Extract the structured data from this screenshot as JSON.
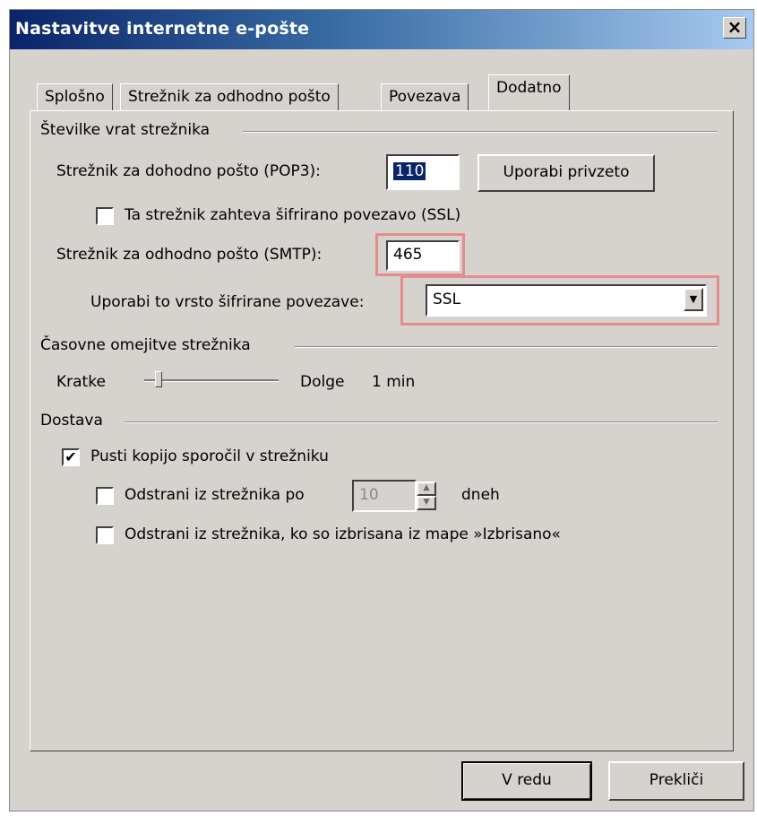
{
  "window": {
    "title": "Nastavitve internetne e-pošte",
    "close_label": "×"
  },
  "tabs": [
    {
      "label": "Splošno",
      "active": false
    },
    {
      "label": "Strežnik za odhodno pošto",
      "active": false
    },
    {
      "label": "Povezava",
      "active": false
    },
    {
      "label": "Dodatno",
      "active": true
    }
  ],
  "ports": {
    "group_title": "Številke vrat strežnika",
    "pop3_label": "Strežnik za dohodno pošto (POP3):",
    "pop3_value": "110",
    "use_default_button": "Uporabi privzeto",
    "ssl_checkbox_label": "Ta strežnik zahteva šifrirano povezavo (SSL)",
    "ssl_checked": false,
    "smtp_label": "Strežnik za odhodno pošto (SMTP):",
    "smtp_value": "465",
    "encryption_label": "Uporabi to vrsto šifrirane povezave:",
    "encryption_value": "SSL"
  },
  "timeouts": {
    "group_title": "Časovne omejitve strežnika",
    "short_label": "Kratke",
    "long_label": "Dolge",
    "value_label": "1 min"
  },
  "delivery": {
    "group_title": "Dostava",
    "leave_copy_label": "Pusti kopijo sporočil v strežniku",
    "leave_copy_checked": true,
    "remove_after_label": "Odstrani iz strežnika po",
    "remove_after_checked": false,
    "remove_after_days": "10",
    "days_unit": "dneh",
    "remove_deleted_label": "Odstrani iz strežnika, ko so izbrisana iz mape »Izbrisano«",
    "remove_deleted_checked": false
  },
  "footer": {
    "ok_label": "V redu",
    "cancel_label": "Prekliči"
  },
  "colors": {
    "highlight": "#e58c8c",
    "title_gradient_start": "#0a246a",
    "dialog_bg": "#d6d3ce"
  },
  "icons": {
    "close": "close-icon",
    "dropdown": "chevron-down-icon",
    "check": "checkmark-icon",
    "spin_up": "spin-up-icon",
    "spin_down": "spin-down-icon"
  }
}
